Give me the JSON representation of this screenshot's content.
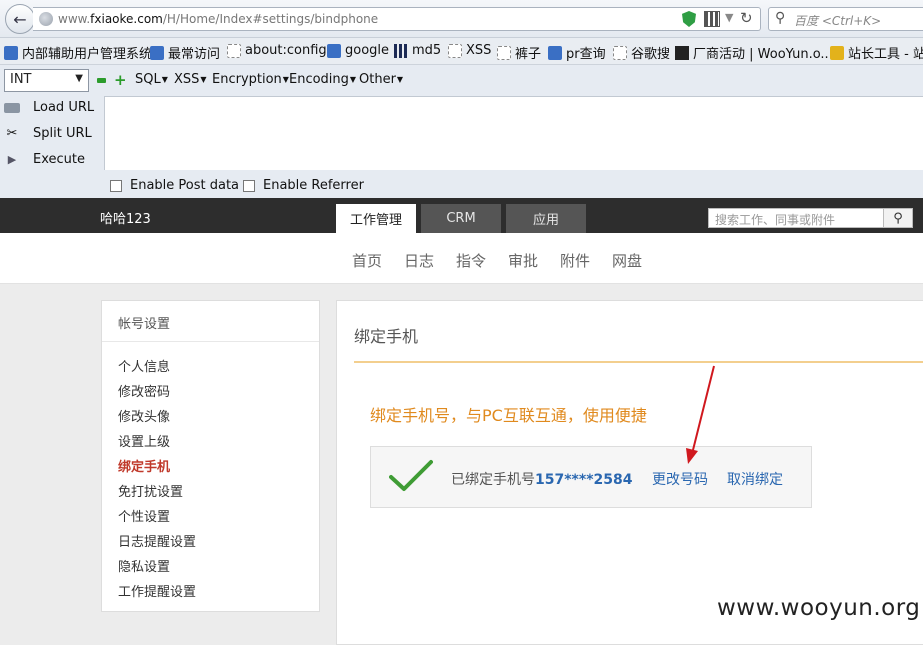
{
  "browser": {
    "url_prefix": "www.",
    "url_domain": "fxiaoke.com",
    "url_path": "/H/Home/Index#settings/bindphone",
    "search_placeholder": "百度 <Ctrl+K>"
  },
  "bookmarks": [
    {
      "label": "内部辅助用户管理系统",
      "icon": "blue-icon"
    },
    {
      "label": "最常访问",
      "icon": "blue-icon"
    },
    {
      "label": "about:config",
      "icon": "page-icon"
    },
    {
      "label": "google",
      "icon": "google-icon"
    },
    {
      "label": "md5",
      "icon": "grid-icon"
    },
    {
      "label": "XSS",
      "icon": "page-icon"
    },
    {
      "label": "裤子",
      "icon": "page-icon"
    },
    {
      "label": "pr查询",
      "icon": "pr-icon"
    },
    {
      "label": "谷歌搜",
      "icon": "page-icon"
    },
    {
      "label": "厂商活动 | WooYun.o...",
      "icon": "wooyun-icon"
    },
    {
      "label": "站长工具 - 站",
      "icon": "yellow-icon"
    }
  ],
  "hackbar": {
    "select_value": "INT",
    "menus": [
      "SQL",
      "XSS",
      "Encryption",
      "Encoding",
      "Other"
    ],
    "actions": [
      "Load URL",
      "Split URL",
      "Execute"
    ],
    "options": [
      "Enable Post data",
      "Enable Referrer"
    ]
  },
  "site": {
    "username": "哈哈123",
    "tabs": [
      "工作管理",
      "CRM",
      "应用"
    ],
    "search_placeholder": "搜索工作、同事或附件",
    "subnav": [
      "首页",
      "日志",
      "指令",
      "审批",
      "附件",
      "网盘"
    ]
  },
  "sidebar": {
    "title": "帐号设置",
    "items": [
      "个人信息",
      "修改密码",
      "修改头像",
      "设置上级",
      "绑定手机",
      "免打扰设置",
      "个性设置",
      "日志提醒设置",
      "隐私设置",
      "工作提醒设置"
    ],
    "active_index": 4
  },
  "main": {
    "title": "绑定手机",
    "promo": "绑定手机号，与PC互联互通，使用便捷",
    "bound_label": "已绑定手机号",
    "phone": "157****2584",
    "change_link": "更改号码",
    "unbind_link": "取消绑定"
  },
  "watermark": "www.wooyun.org",
  "colors": {
    "accent_orange": "#e08a1e",
    "link_blue": "#2a67b0",
    "active_red": "#c0392b",
    "arrow_red": "#d0181e",
    "check_green": "#3f9c35"
  }
}
